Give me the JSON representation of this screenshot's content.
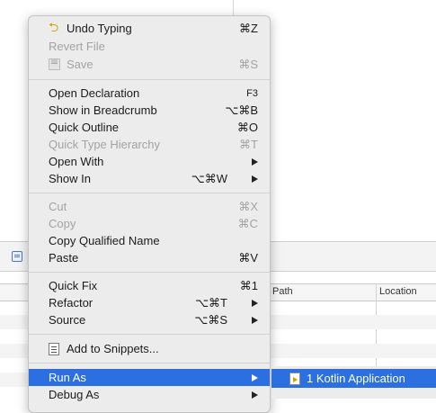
{
  "background": {
    "table_columns": [
      "Path",
      "Location"
    ]
  },
  "menu": {
    "group1": [
      {
        "label": "Undo Typing",
        "shortcut": "⌘Z",
        "icon": "undo-arrow-icon",
        "enabled": true
      },
      {
        "label": "Revert File",
        "shortcut": "",
        "enabled": false
      },
      {
        "label": "Save",
        "shortcut": "⌘S",
        "icon": "save-disk-icon",
        "enabled": false
      }
    ],
    "group2": [
      {
        "label": "Open Declaration",
        "shortcut": "F3",
        "enabled": true
      },
      {
        "label": "Show in Breadcrumb",
        "shortcut": "⌥⌘B",
        "enabled": true
      },
      {
        "label": "Quick Outline",
        "shortcut": "⌘O",
        "enabled": true
      },
      {
        "label": "Quick Type Hierarchy",
        "shortcut": "⌘T",
        "enabled": false
      },
      {
        "label": "Open With",
        "submenu": true,
        "enabled": true
      },
      {
        "label": "Show In",
        "shortcut": "⌥⌘W",
        "submenu": true,
        "enabled": true
      }
    ],
    "group3": [
      {
        "label": "Cut",
        "shortcut": "⌘X",
        "enabled": false
      },
      {
        "label": "Copy",
        "shortcut": "⌘C",
        "enabled": false
      },
      {
        "label": "Copy Qualified Name",
        "enabled": true
      },
      {
        "label": "Paste",
        "shortcut": "⌘V",
        "enabled": true
      }
    ],
    "group4": [
      {
        "label": "Quick Fix",
        "shortcut": "⌘1",
        "enabled": true
      },
      {
        "label": "Refactor",
        "shortcut": "⌥⌘T",
        "submenu": true,
        "enabled": true
      },
      {
        "label": "Source",
        "shortcut": "⌥⌘S",
        "submenu": true,
        "enabled": true
      }
    ],
    "group5": [
      {
        "label": "Add to Snippets...",
        "icon": "snippet-icon",
        "enabled": true
      }
    ],
    "group6": [
      {
        "label": "Run As",
        "submenu": true,
        "selected": true
      },
      {
        "label": "Debug As",
        "submenu": true
      }
    ]
  },
  "submenu": {
    "items": [
      {
        "label": "1 Kotlin Application",
        "icon": "kotlin-application-icon",
        "selected": true
      }
    ]
  },
  "colors": {
    "selection": "#2c6fe0",
    "menu_bg": "#ececec",
    "disabled_text": "#a3a3a3"
  }
}
